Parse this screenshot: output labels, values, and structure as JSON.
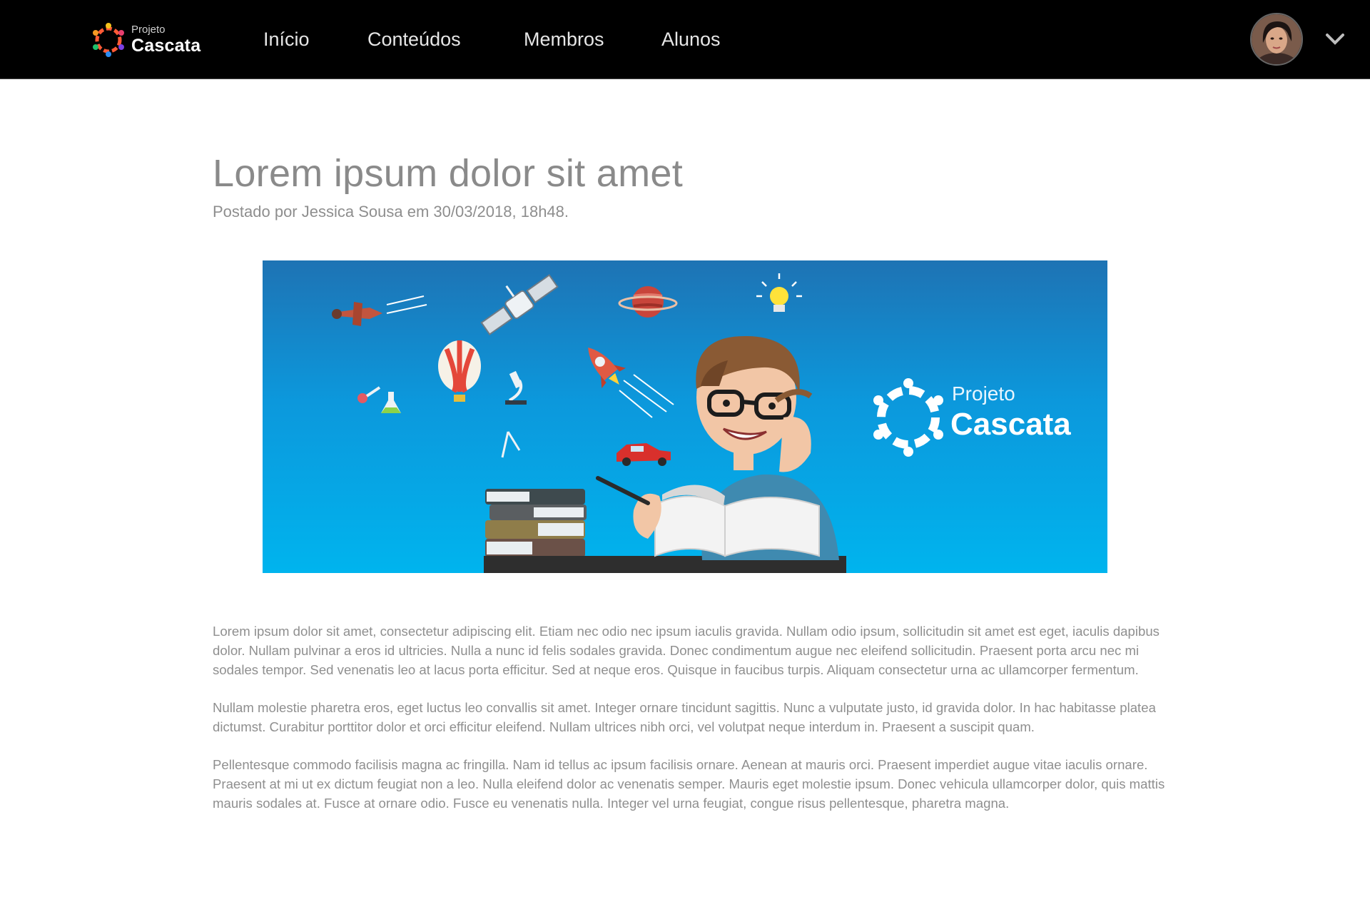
{
  "nav": {
    "brand_small": "Projeto",
    "brand_big": "Cascata",
    "items": [
      "Início",
      "Conteúdos",
      "Membros",
      "Alunos"
    ],
    "user_menu_icon": "chevron-down-icon"
  },
  "article": {
    "title": "Lorem ipsum dolor sit amet",
    "byline": "Postado por Jessica Sousa em 30/03/2018, 18h48.",
    "banner": {
      "brand_small": "Projeto",
      "brand_big": "Cascata"
    },
    "paragraphs": [
      "Lorem ipsum dolor sit amet, consectetur adipiscing elit. Etiam nec odio nec ipsum iaculis gravida. Nullam odio ipsum, sollicitudin sit amet est eget, iaculis dapibus dolor. Nullam pulvinar a eros id ultricies. Nulla a nunc id felis sodales gravida. Donec condimentum augue nec eleifend sollicitudin. Praesent porta arcu nec mi sodales tempor. Sed venenatis leo at lacus porta efficitur. Sed at neque eros. Quisque in faucibus turpis. Aliquam consectetur urna ac ullamcorper fermentum.",
      "Nullam molestie pharetra eros, eget luctus leo convallis sit amet. Integer ornare tincidunt sagittis. Nunc a vulputate justo, id gravida dolor. In hac habitasse platea dictumst. Curabitur porttitor dolor et orci efficitur eleifend. Nullam ultrices nibh orci, vel volutpat neque interdum in. Praesent a suscipit quam.",
      "Pellentesque commodo facilisis magna ac fringilla. Nam id tellus ac ipsum facilisis ornare. Aenean at mauris orci. Praesent imperdiet augue vitae iaculis ornare. Praesent at mi ut ex dictum feugiat non a leo. Nulla eleifend dolor ac venenatis semper. Mauris eget molestie ipsum. Donec vehicula ullamcorper dolor, quis mattis mauris sodales at. Fusce at ornare odio. Fusce eu venenatis nulla. Integer vel urna feugiat, congue risus pellentesque, pharetra magna."
    ]
  },
  "colors": {
    "nav_bg": "#000000",
    "banner_top": "#1e73b4",
    "banner_bottom": "#00b4ee",
    "text_gray": "#8f8f8f"
  }
}
